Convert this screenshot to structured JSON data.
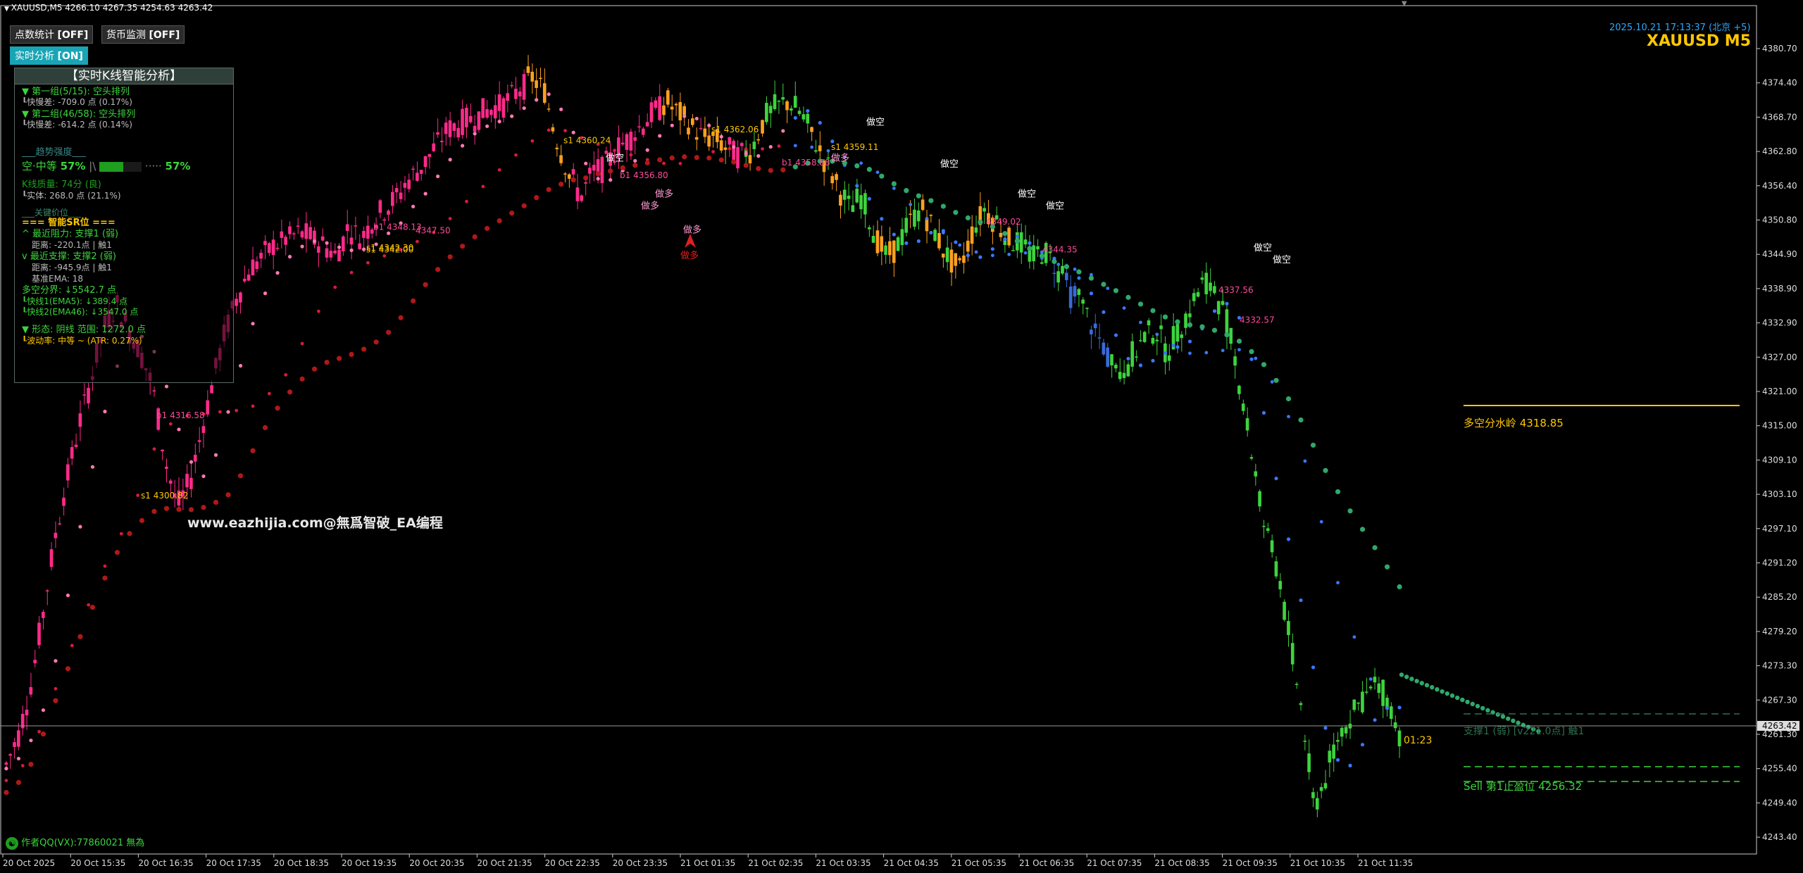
{
  "header": {
    "symbol_line": "XAUUSD,M5  4266.10 4267.35 4254.63 4263.42",
    "datetime": "2025.10.21 17:13:37 (北京 +5)",
    "symbol_big": "XAUUSD M5"
  },
  "buttons": {
    "points_stats": {
      "label": "点数统计",
      "state": "[OFF]"
    },
    "currency_monitor": {
      "label": "货币监测",
      "state": "[OFF]"
    },
    "realtime_analysis": {
      "label": "实时分析",
      "state": "[ON]"
    }
  },
  "panel": {
    "title": "【实时K线智能分析】",
    "group1": "▼ 第一组(5/15): 空头排列",
    "group1_diff": "┖快慢差: -709.0 点 (0.17%)",
    "group2": "▼ 第二组(46/58): 空头排列",
    "group2_diff": "┖快慢差: -614.2 点 (0.14%)",
    "trend_header": "___趋势强度___",
    "trend_label": "空·中等",
    "trend_pct_a": "57%",
    "trend_pct_b": "57%",
    "trend_value": 0.57,
    "kline_quality": "K线质量: 74分 (良)",
    "kline_body": "┖实体: 268.0 点 (21.1%)",
    "key_header": "___关键价位___",
    "sr_header": "=== 智能SR位 ===",
    "resistance": "^ 最近阻力: 支撑1 (弱)",
    "resistance_dist": "距离: -220.1点 | 触1",
    "support": "v 最近支撑: 支撑2 (弱)",
    "support_dist": "距离: -945.9点 | 触1",
    "base_ema": "基准EMA: 18",
    "divider": "多空分界: ↓5542.7 点",
    "fast1": "┖快线1(EMA5): ↓389.4 点",
    "fast2": "┖快线2(EMA46): ↓3547.0 点",
    "pattern": "▼ 形态: 阴线  范围: 1272.0 点",
    "volatility": "┖波动率: 中等 ~ (ATR: 0.27%)"
  },
  "watermark": "www.eazhijia.com@無爲智破_EA编程",
  "author": "作者QQ(VX):77860021 無為",
  "right_labels": {
    "watershed": "多空分水岭 4318.85",
    "support1": "支撑1 (弱) [v221.0点] 触1",
    "sell_tp": "Sell 第1止盈位 4256.32",
    "timer": "01:23"
  },
  "chart_data": {
    "type": "candlestick",
    "price_axis": [
      "4380.70",
      "4374.40",
      "4368.70",
      "4362.80",
      "4356.40",
      "4350.80",
      "4344.90",
      "4338.90",
      "4332.90",
      "4327.00",
      "4321.00",
      "4315.00",
      "4309.10",
      "4303.10",
      "4297.10",
      "4291.20",
      "4285.20",
      "4279.20",
      "4273.30",
      "4267.30",
      "4261.30",
      "4255.40",
      "4249.40",
      "4243.40"
    ],
    "current_price": "4263.42",
    "time_axis": [
      "20 Oct 2025",
      "20 Oct 15:35",
      "20 Oct 16:35",
      "20 Oct 17:35",
      "20 Oct 18:35",
      "20 Oct 19:35",
      "20 Oct 20:35",
      "20 Oct 21:35",
      "20 Oct 22:35",
      "20 Oct 23:35",
      "21 Oct 01:35",
      "21 Oct 02:35",
      "21 Oct 03:35",
      "21 Oct 04:35",
      "21 Oct 05:35",
      "21 Oct 06:35",
      "21 Oct 07:35",
      "21 Oct 08:35",
      "21 Oct 09:35",
      "21 Oct 10:35",
      "21 Oct 11:35"
    ],
    "ylim": [
      4240,
      4384
    ],
    "price_path": [
      4257,
      4262,
      4270,
      4282,
      4295,
      4305,
      4314,
      4322,
      4330,
      4334,
      4330,
      4326,
      4320,
      4308,
      4300,
      4304,
      4313,
      4322,
      4330,
      4336,
      4340,
      4342,
      4344,
      4345,
      4346,
      4345,
      4344,
      4342,
      4347,
      4345,
      4348,
      4350,
      4352,
      4355,
      4357,
      4360,
      4363,
      4364,
      4365,
      4366,
      4367,
      4368,
      4370,
      4372,
      4370,
      4362,
      4356,
      4352,
      4356,
      4357,
      4360,
      4362,
      4364,
      4366,
      4368,
      4366,
      4364,
      4362,
      4362,
      4360,
      4359,
      4360,
      4365,
      4367,
      4368,
      4366,
      4362,
      4358,
      4354,
      4350,
      4352,
      4346,
      4342,
      4344,
      4348,
      4350,
      4346,
      4342,
      4340,
      4346,
      4350,
      4348,
      4345,
      4344,
      4342,
      4343,
      4340,
      4336,
      4334,
      4330,
      4326,
      4322,
      4325,
      4328,
      4330,
      4326,
      4330,
      4334,
      4338,
      4336,
      4330,
      4320,
      4308,
      4296,
      4290,
      4278,
      4266,
      4250,
      4255,
      4262,
      4265,
      4268,
      4270,
      4268,
      4262
    ],
    "signals": [
      {
        "text": "s1 4300.82",
        "price": 4300.82
      },
      {
        "text": "b1 4316.58",
        "price": 4316.58
      },
      {
        "text": "s1 4342.00",
        "price": 4342.0
      },
      {
        "text": "s1 4342.30",
        "price": 4342.3
      },
      {
        "text": "4347.50",
        "price": 4347.5
      },
      {
        "text": "b1 4348.13",
        "price": 4348.13
      },
      {
        "text": "s1 4360.24",
        "price": 4360.24
      },
      {
        "text": "b1 4356.80",
        "price": 4356.8
      },
      {
        "text": "s1 4362.06",
        "price": 4362.06
      },
      {
        "text": "b1 4358.88",
        "price": 4358.88
      },
      {
        "text": "s1 4359.11",
        "price": 4359.11
      },
      {
        "text": "4349.02",
        "price": 4349.02
      },
      {
        "text": "4344.35",
        "price": 4344.35
      },
      {
        "text": "4332.57",
        "price": 4332.57
      },
      {
        "text": "4337.56",
        "price": 4337.56
      }
    ],
    "markers": [
      "做多",
      "做多",
      "做多",
      "做多",
      "做空",
      "做空",
      "做空",
      "做空",
      "做空",
      "做空",
      "做空"
    ],
    "series": [
      {
        "color": "#ff7ab4"
      },
      {
        "color": "#d81b3c"
      },
      {
        "color": "#b01818"
      },
      {
        "color": "#3a78ff"
      },
      {
        "color": "#1e9e60"
      }
    ],
    "colors": {
      "bull": "#ff2a8a",
      "bear_orange": "#ffa020",
      "bear_green": "#3dd43d",
      "down": "#3a6ad8"
    }
  }
}
